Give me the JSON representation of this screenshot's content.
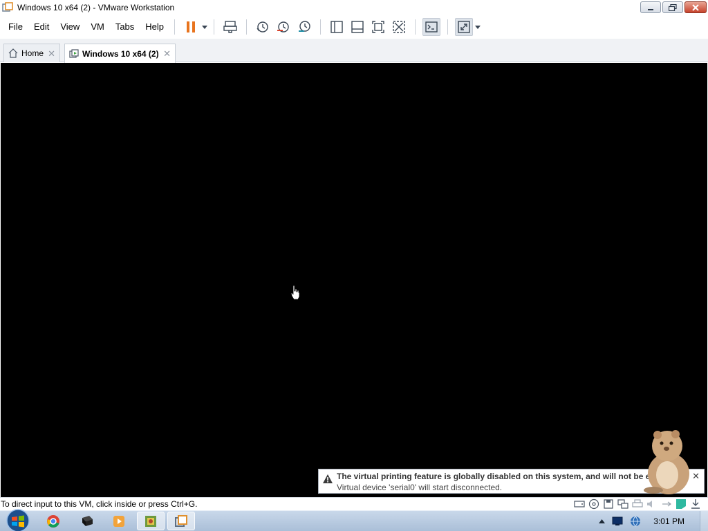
{
  "window": {
    "title": "Windows 10 x64 (2) - VMware Workstation"
  },
  "menu": {
    "items": [
      "File",
      "Edit",
      "View",
      "VM",
      "Tabs",
      "Help"
    ]
  },
  "toolbar": {
    "buttons": [
      {
        "icon": "pause-icon"
      },
      {
        "icon": "send-ctrl-alt-del-icon"
      },
      {
        "icon": "take-snapshot-icon"
      },
      {
        "icon": "revert-snapshot-icon"
      },
      {
        "icon": "snapshot-manager-icon"
      },
      {
        "icon": "show-library-icon"
      },
      {
        "icon": "thumbnail-bar-icon"
      },
      {
        "icon": "full-screen-icon"
      },
      {
        "icon": "unity-icon"
      },
      {
        "icon": "console-view-icon"
      },
      {
        "icon": "stretch-guest-icon"
      }
    ]
  },
  "tabs": [
    {
      "label": "Home",
      "icon": "home-icon"
    },
    {
      "label": "Windows 10 x64 (2)",
      "icon": "vm-icon"
    }
  ],
  "notification": {
    "line1": "The virtual printing feature is globally disabled on this system, and will not be enabled",
    "line2": "Virtual device 'serial0' will start disconnected."
  },
  "statusbar": {
    "text": "To direct input to this VM, click inside or press Ctrl+G.",
    "icons": [
      "hard-disk-icon",
      "cd-dvd-icon",
      "floppy-icon",
      "network-adapter-icon",
      "printer-icon",
      "sound-icon",
      "usb-icon",
      "message-icon",
      "stretch-icon"
    ]
  },
  "taskbar": {
    "apps": [
      "chrome-icon",
      "terminal-icon",
      "media-player-icon",
      "photo-viewer-icon",
      "vmware-icon"
    ],
    "clock": "3:01 PM"
  },
  "colors": {
    "console": "#000000",
    "pause_accent": "#e8741e",
    "taskbar": "#b8cce3"
  }
}
